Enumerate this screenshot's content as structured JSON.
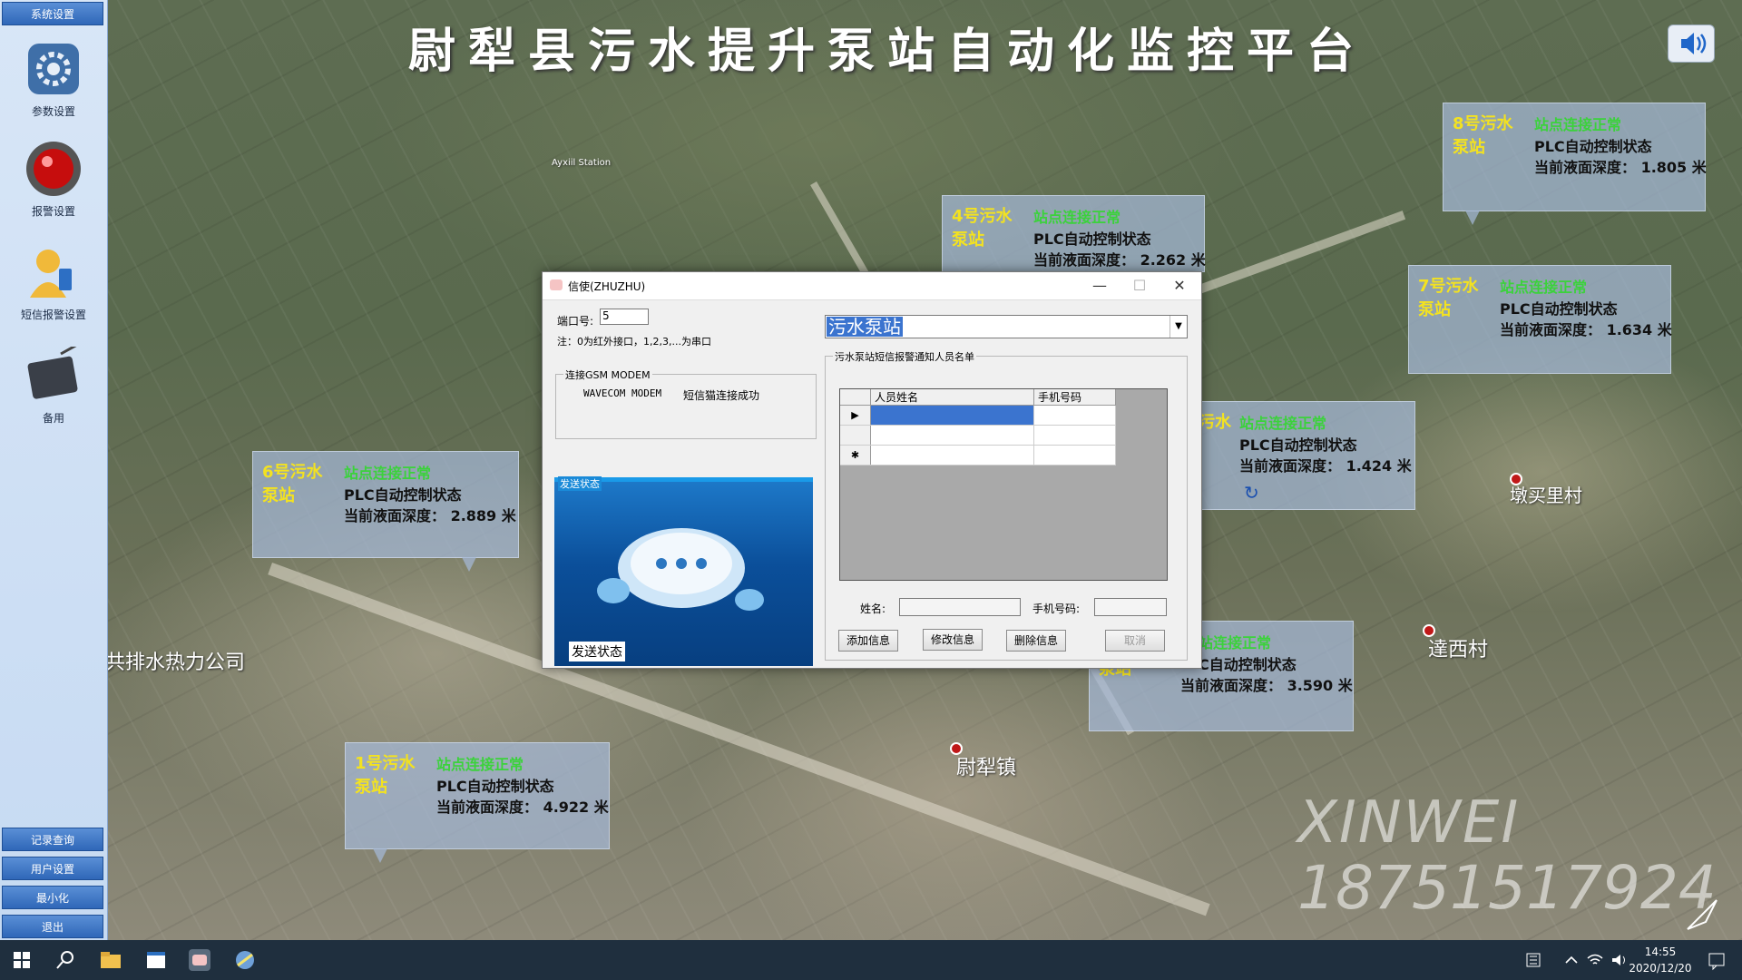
{
  "app": {
    "title": "尉犁县污水提升泵站自动化监控平台"
  },
  "sidebar": {
    "top_button": "系统设置",
    "items": [
      {
        "label": "参数设置",
        "icon": "gear-icon"
      },
      {
        "label": "报警设置",
        "icon": "alarm-light-icon"
      },
      {
        "label": "短信报警设置",
        "icon": "user-sms-icon"
      },
      {
        "label": "备用",
        "icon": "tablet-pen-icon"
      }
    ],
    "bottom_buttons": [
      "记录查询",
      "用户设置",
      "最小化",
      "退出"
    ]
  },
  "stations": [
    {
      "name": "8号污水泵站",
      "status": "站点连接正常",
      "plc": "PLC自动控制状态",
      "depth": "当前液面深度： 1.805 米"
    },
    {
      "name": "4号污水泵站",
      "status": "站点连接正常",
      "plc": "PLC自动控制状态",
      "depth": "当前液面深度： 2.262 米"
    },
    {
      "name": "7号污水泵站",
      "status": "站点连接正常",
      "plc": "PLC自动控制状态",
      "depth": "当前液面深度： 1.634 米"
    },
    {
      "name": "污水",
      "status": "站点连接正常",
      "plc": "PLC自动控制状态",
      "depth": "当前液面深度： 1.424 米"
    },
    {
      "name": "6号污水泵站",
      "status": "站点连接正常",
      "plc": "PLC自动控制状态",
      "depth": "当前液面深度： 2.889 米"
    },
    {
      "name": "泵站",
      "status": "站连接正常",
      "plc": "C自动控制状态",
      "depth": "当前液面深度： 3.590 米"
    },
    {
      "name": "1号污水泵站",
      "status": "站点连接正常",
      "plc": "PLC自动控制状态",
      "depth": "当前液面深度： 4.922 米"
    }
  ],
  "map_labels": {
    "village1": "墩买里村",
    "village2": "達西村",
    "town": "尉犁镇",
    "company": "共排水热力公司",
    "road": "Ayxiil Station"
  },
  "watermark": {
    "line1": "XINWEI",
    "line2": "18751517924"
  },
  "dialog": {
    "title": "信使(ZHUZHU)",
    "port_label": "端口号:",
    "port_value": "5",
    "note": "注：0为红外接口，1,2,3,...为串口",
    "modem_group": "连接GSM MODEM",
    "modem_name": "WAVECOM MODEM",
    "modem_status": "短信猫连接成功",
    "send_group": "发送状态",
    "send_status": "发送状态",
    "combo_value": "污水泵站",
    "list_group": "污水泵站短信报警通知人员名单",
    "columns": [
      "人员姓名",
      "手机号码"
    ],
    "rows": [
      {
        "marker": "▶",
        "name": "",
        "phone": ""
      },
      {
        "marker": "",
        "name": "",
        "phone": ""
      },
      {
        "marker": "✱",
        "name": "",
        "phone": ""
      }
    ],
    "name_label": "姓名:",
    "phone_label": "手机号码:",
    "buttons": {
      "add": "添加信息",
      "edit": "修改信息",
      "delete": "删除信息",
      "cancel": "取消"
    },
    "win_buttons": {
      "minimize": "—",
      "maximize": "☐",
      "close": "✕"
    }
  },
  "taskbar": {
    "time": "14:55",
    "date": "2020/12/20"
  },
  "colors": {
    "station_name": "#f3e220",
    "station_status": "#3bd23b",
    "sidebar_button": "#2f67b8"
  }
}
